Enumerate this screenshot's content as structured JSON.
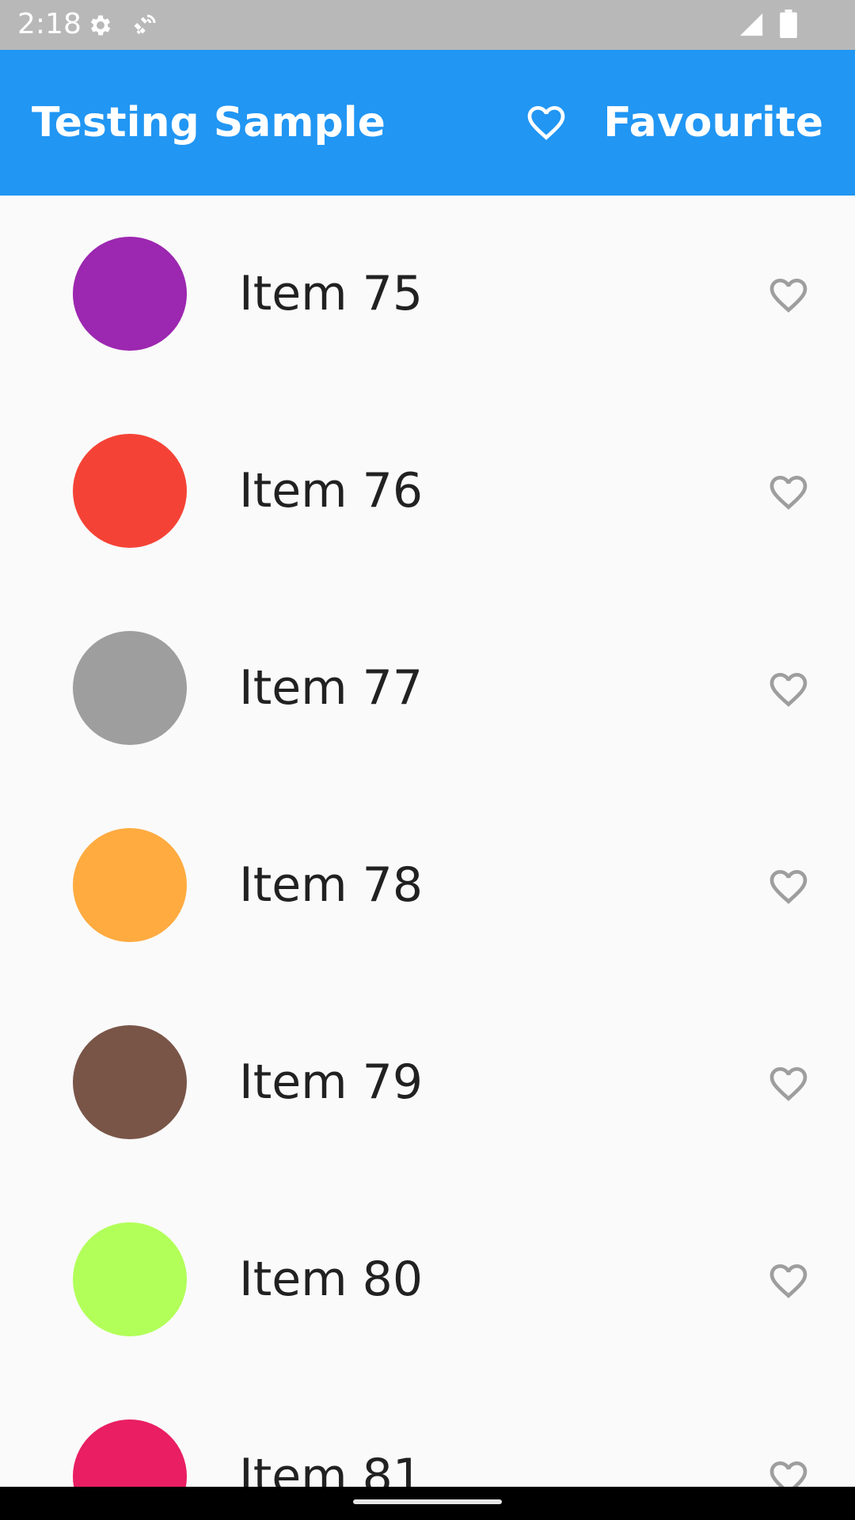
{
  "status_bar": {
    "time": "2:18",
    "icons": [
      "gear-icon",
      "satellite-icon",
      "signal-icon",
      "battery-icon"
    ]
  },
  "app_bar": {
    "title": "Testing Sample",
    "action_label": "Favourite",
    "action_icon": "heart-outline-icon",
    "color": "#2196f3"
  },
  "items": [
    {
      "label": "Item 75",
      "color": "#9c27b0"
    },
    {
      "label": "Item 76",
      "color": "#f44336"
    },
    {
      "label": "Item 77",
      "color": "#9e9e9e"
    },
    {
      "label": "Item 78",
      "color": "#ffab40"
    },
    {
      "label": "Item 79",
      "color": "#795548"
    },
    {
      "label": "Item 80",
      "color": "#b2ff59"
    },
    {
      "label": "Item 81",
      "color": "#e91e63"
    }
  ],
  "item_favorite_icon": "heart-outline-icon"
}
